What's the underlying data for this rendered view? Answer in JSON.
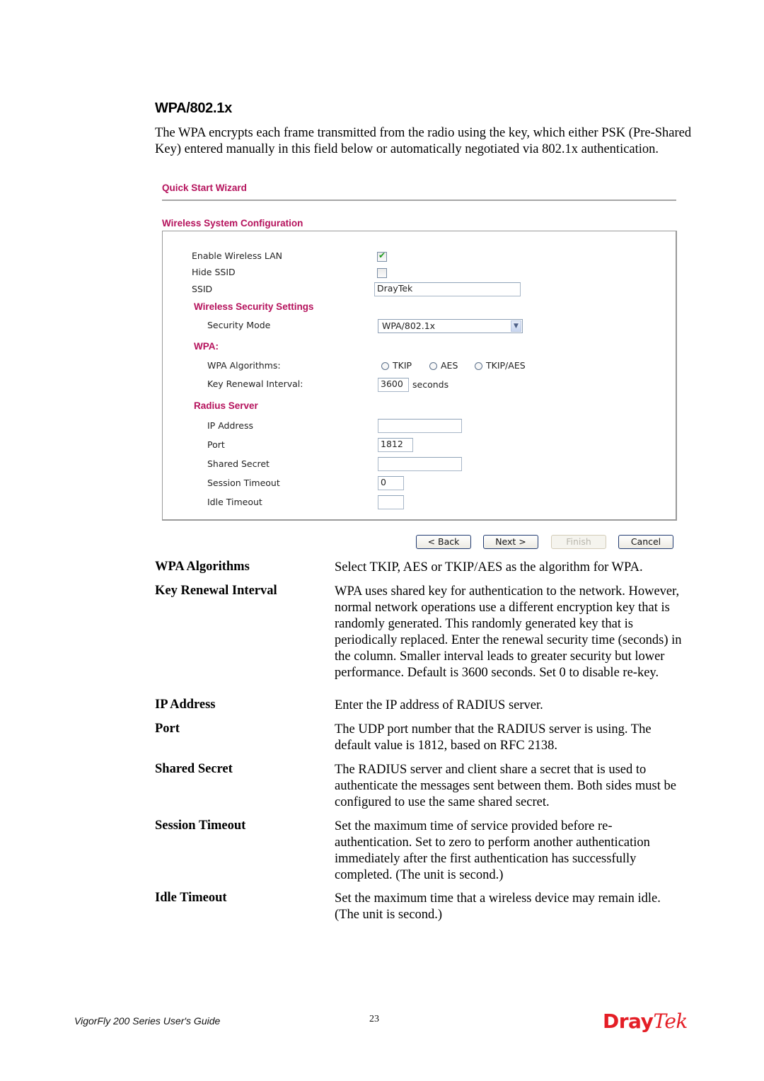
{
  "section": {
    "title": "WPA/802.1x",
    "intro": "The WPA encrypts each frame transmitted from the radio using the key, which either PSK (Pre-Shared Key) entered manually in this field below or automatically negotiated via 802.1x authentication."
  },
  "wizard": {
    "title": "Quick Start Wizard",
    "config_title": "Wireless System Configuration",
    "fields": {
      "enable_wlan": {
        "label": "Enable Wireless LAN",
        "checked": true
      },
      "hide_ssid": {
        "label": "Hide SSID",
        "checked": false
      },
      "ssid": {
        "label": "SSID",
        "value": "DrayTek"
      }
    },
    "security": {
      "heading": "Wireless Security Settings",
      "mode_label": "Security Mode",
      "mode_value": "WPA/802.1x"
    },
    "wpa": {
      "heading": "WPA:",
      "algorithms_label": "WPA Algorithms:",
      "algorithms": [
        "TKIP",
        "AES",
        "TKIP/AES"
      ],
      "key_renewal_label": "Key Renewal Interval:",
      "key_renewal_value": "3600",
      "key_renewal_unit": "seconds"
    },
    "radius": {
      "heading": "Radius Server",
      "ip_label": "IP Address",
      "ip_value": "",
      "port_label": "Port",
      "port_value": "1812",
      "secret_label": "Shared Secret",
      "secret_value": "",
      "session_label": "Session Timeout",
      "session_value": "0",
      "idle_label": "Idle Timeout",
      "idle_value": ""
    },
    "buttons": {
      "back": "< Back",
      "next": "Next >",
      "finish": "Finish",
      "cancel": "Cancel"
    }
  },
  "definitions": [
    {
      "term": "WPA Algorithms",
      "desc": "Select TKIP, AES or TKIP/AES as the algorithm for WPA."
    },
    {
      "term": "Key Renewal Interval",
      "desc": "WPA uses shared key for authentication to the network. However, normal network operations use a different encryption key that is randomly generated. This randomly generated key that is periodically replaced. Enter the renewal security time (seconds) in the column. Smaller interval leads to greater security but lower performance. Default is 3600 seconds. Set 0 to disable re-key."
    },
    {
      "term": "IP Address",
      "desc": "Enter the IP address of RADIUS server."
    },
    {
      "term": "Port",
      "desc": "The UDP port number that the RADIUS server is using. The default value is 1812, based on RFC 2138."
    },
    {
      "term": "Shared Secret",
      "desc": "The RADIUS server and client share a secret that is used to authenticate the messages sent between them. Both sides must be configured to use the same shared secret."
    },
    {
      "term": "Session Timeout",
      "desc": "Set the maximum time of service provided before re-authentication. Set to zero to perform another authentication immediately after the first authentication has successfully completed. (The unit is second.)"
    },
    {
      "term": "Idle Timeout",
      "desc": "Set the maximum time that a wireless device may remain idle. (The unit is second.)"
    }
  ],
  "footer": {
    "guide_title": "VigorFly 200 Series User's Guide",
    "page_number": "23",
    "logo_part1": "Dray",
    "logo_part2": "Tek"
  },
  "colors": {
    "heading_accent": "#b5125c",
    "logo_red": "#e41e26"
  }
}
